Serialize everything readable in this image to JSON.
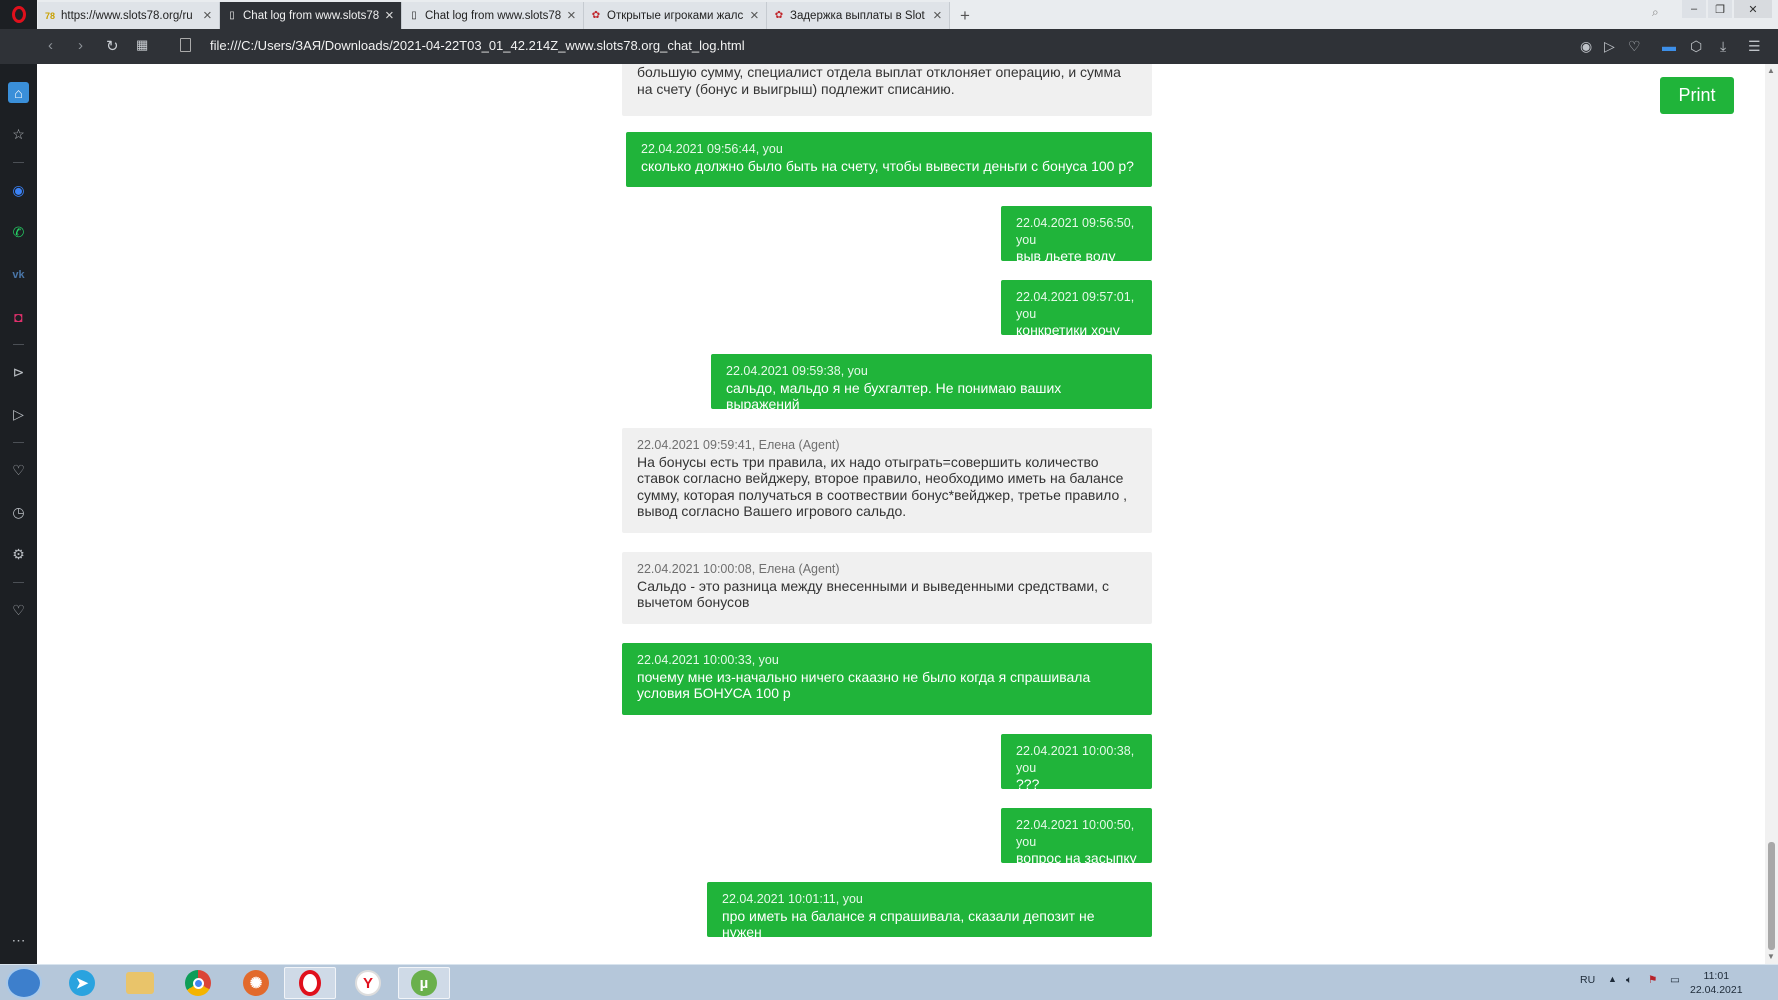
{
  "browser": {
    "tabs": [
      {
        "title": "https://www.slots78.org/ru",
        "favicon": "78"
      },
      {
        "title": "Chat log from www.slots78",
        "favicon": "page"
      },
      {
        "title": "Chat log from www.slots78",
        "favicon": "page"
      },
      {
        "title": "Открытые игроками жалс",
        "favicon": "casino"
      },
      {
        "title": "Задержка выплаты в Slot",
        "favicon": "casino"
      }
    ],
    "url": "file:///C:/Users/ЗАЯ/Downloads/2021-04-22T03_01_42.214Z_www.slots78.org_chat_log.html"
  },
  "page": {
    "print_label": "Print",
    "messages": [
      {
        "role": "agent",
        "meta": "",
        "text": "большую сумму, специалист отдела выплат отклоняет операцию, и сумма на счету (бонус и выигрыш) подлежит списанию."
      },
      {
        "role": "user",
        "meta": "22.04.2021 09:56:44, you",
        "text": "сколько должно было быть на счету, чтобы вывести деньги с бонуса 100 р?"
      },
      {
        "role": "user",
        "meta": "22.04.2021 09:56:50, you",
        "text": "выв льете воду"
      },
      {
        "role": "user",
        "meta": "22.04.2021 09:57:01, you",
        "text": "конкретики хочу"
      },
      {
        "role": "user",
        "meta": "22.04.2021 09:59:38, you",
        "text": "сальдо, мальдо я не бухгалтер. Не понимаю ваших выражений"
      },
      {
        "role": "agent",
        "meta": "22.04.2021 09:59:41, Елена (Agent)",
        "text": "На бонусы есть три правила, их надо отыграть=совершить количество ставок согласно вейджеру, второе правило, необходимо иметь на балансе сумму, которая получаться в соотвествии бонус*вейджер, третье правило , вывод согласно Вашего игрового сальдо."
      },
      {
        "role": "agent",
        "meta": "22.04.2021 10:00:08, Елена (Agent)",
        "text": "Сальдо - это разница между внесенными и выведенными средствами, с вычетом бонусов"
      },
      {
        "role": "user",
        "meta": "22.04.2021 10:00:33, you",
        "text": "почему мне из-начально ничего скаазно не было когда я спрашивала условия БОНУСА 100 р"
      },
      {
        "role": "user",
        "meta": "22.04.2021 10:00:38, you",
        "text": "???"
      },
      {
        "role": "user",
        "meta": "22.04.2021 10:00:50, you",
        "text": "вопрос на засыпку"
      },
      {
        "role": "user",
        "meta": "22.04.2021 10:01:11, you",
        "text": "про иметь на балансе я спрашивала, сказали депозит не нужен"
      }
    ]
  },
  "taskbar": {
    "language": "RU",
    "time": "11:01",
    "date": "22.04.2021",
    "apps": [
      "telegram",
      "explorer",
      "chrome",
      "basketball-app",
      "opera",
      "yandex",
      "utorrent"
    ]
  },
  "colors": {
    "user_bubble": "#20b43a",
    "agent_bubble": "#f0f0f0",
    "print_button": "#20b43a"
  }
}
